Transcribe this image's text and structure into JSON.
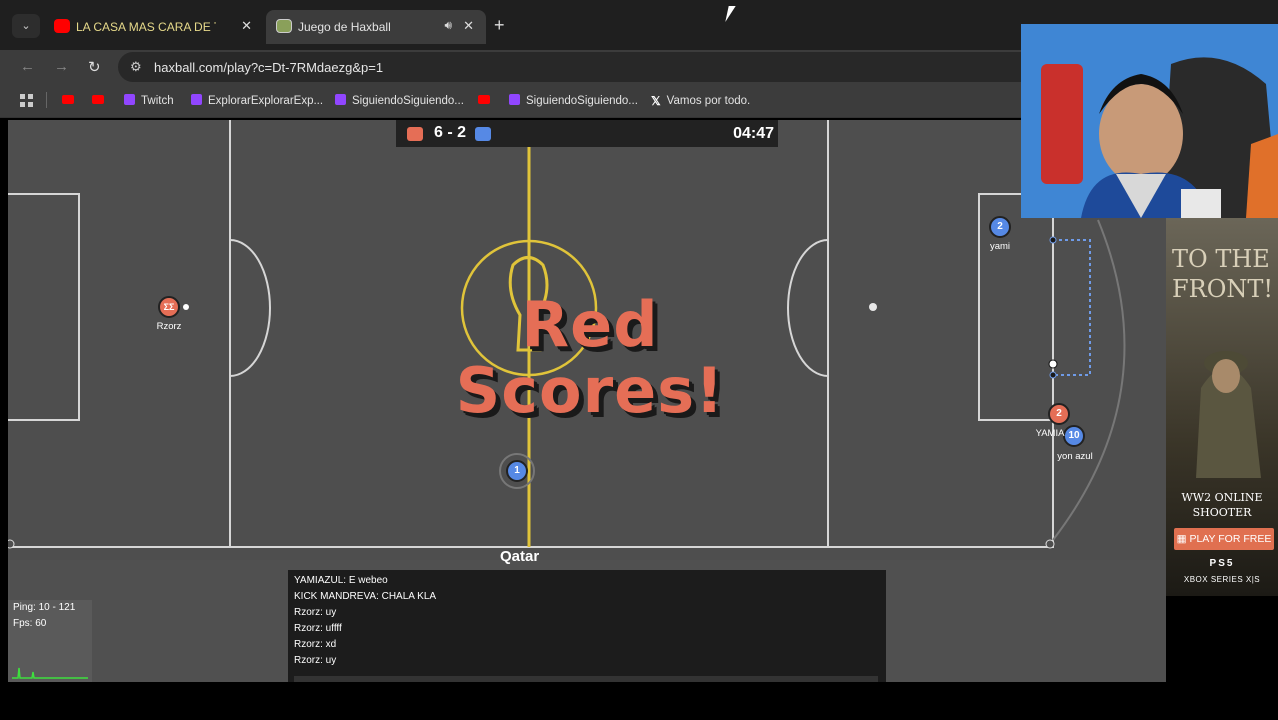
{
  "browser": {
    "tab_inactive": {
      "title": "LA CASA MAS CARA DE TO",
      "close": "✕"
    },
    "tab_active": {
      "title": "Juego de Haxball",
      "close": "✕"
    },
    "new_tab": "+",
    "url": "haxball.com/play?c=Dt-7RMdaezg&p=1"
  },
  "bookmarks": [
    {
      "label": "",
      "icon": "youtube-icon"
    },
    {
      "label": "",
      "icon": "youtube-icon"
    },
    {
      "label": "Twitch",
      "icon": "twitch-icon"
    },
    {
      "label": "ExplorarExplorarExp...",
      "icon": "twitch-icon"
    },
    {
      "label": "SiguiendoSiguiendo...",
      "icon": "twitch-icon"
    },
    {
      "label": "",
      "icon": "youtube-icon"
    },
    {
      "label": "SiguiendoSiguiendo...",
      "icon": "twitch-icon"
    },
    {
      "label": "Vamos por todo.",
      "icon": "x-icon"
    }
  ],
  "game": {
    "score": "6 - 2",
    "timer": "04:47",
    "goal_message_line1": "Red",
    "goal_message_line2": "Scores!",
    "field_logo": "Qatar",
    "colors": {
      "red": "#e56e56",
      "blue": "#5689e5",
      "field": "#4e4e4e",
      "lines": "#c7c7c7"
    },
    "players": [
      {
        "name": "Rzorz",
        "number": "ΣΣ",
        "team": "red"
      },
      {
        "name": "yami",
        "number": "2",
        "team": "blue"
      },
      {
        "name": "YAMIA",
        "number": "2",
        "team": "red"
      },
      {
        "name": "yon azul",
        "number": "10",
        "team": "blue"
      },
      {
        "name": "",
        "number": "1",
        "team": "blue"
      }
    ],
    "chat": [
      "YAMIAZUL: E webeo",
      "KICK MANDREVA: CHALA KLA",
      "Rzorz: uy",
      "Rzorz: uffff",
      "Rzorz: xd",
      "Rzorz: uy"
    ],
    "stats": {
      "ping": "Ping: 10 - 121",
      "fps": "Fps: 60"
    }
  },
  "ad": {
    "title_line1": "TO THE",
    "title_line2": "FRONT!",
    "subtitle_line1": "WW2 ONLINE",
    "subtitle_line2": "SHOOTER",
    "button": "PLAY FOR FREE",
    "platform1": "PS5",
    "platform2": "XBOX SERIES X|S"
  }
}
